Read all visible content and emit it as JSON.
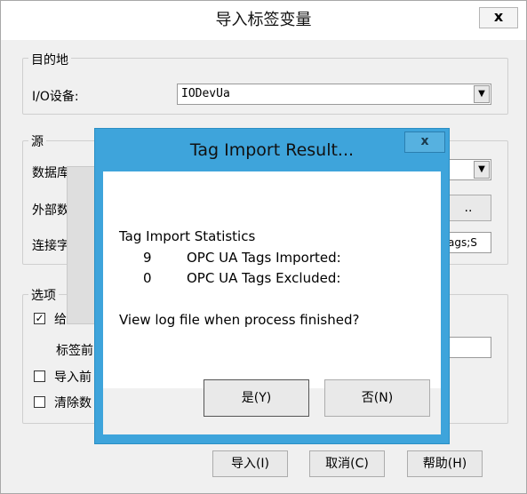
{
  "main_dialog": {
    "title": "导入标签变量",
    "close_label": "x",
    "destination_group": {
      "legend": "目的地",
      "io_device_label": "I/O设备:",
      "io_device_value": "IODevUa"
    },
    "source_group": {
      "legend": "源",
      "database_label": "数据库",
      "external_label": "外部数",
      "connection_label": "连接字",
      "browse_button": "..",
      "connection_value": "ags;S"
    },
    "options_group": {
      "legend": "选项",
      "opt1_label": "给",
      "opt1_checked": true,
      "tag_prefix_label": "标签前",
      "opt2_label": "导入前",
      "opt2_checked": false,
      "opt3_label": "清除数",
      "opt3_checked": false
    },
    "buttons": {
      "import": "导入(I)",
      "cancel": "取消(C)",
      "help": "帮助(H)"
    }
  },
  "modal": {
    "title": "Tag Import Result...",
    "close_label": "x",
    "heading": "Tag Import Statistics",
    "stats": [
      {
        "count": "9",
        "label": "OPC UA Tags Imported:"
      },
      {
        "count": "0",
        "label": "OPC UA Tags Excluded:"
      }
    ],
    "question": "View log file when process finished?",
    "yes_button": "是(Y)",
    "no_button": "否(N)"
  }
}
